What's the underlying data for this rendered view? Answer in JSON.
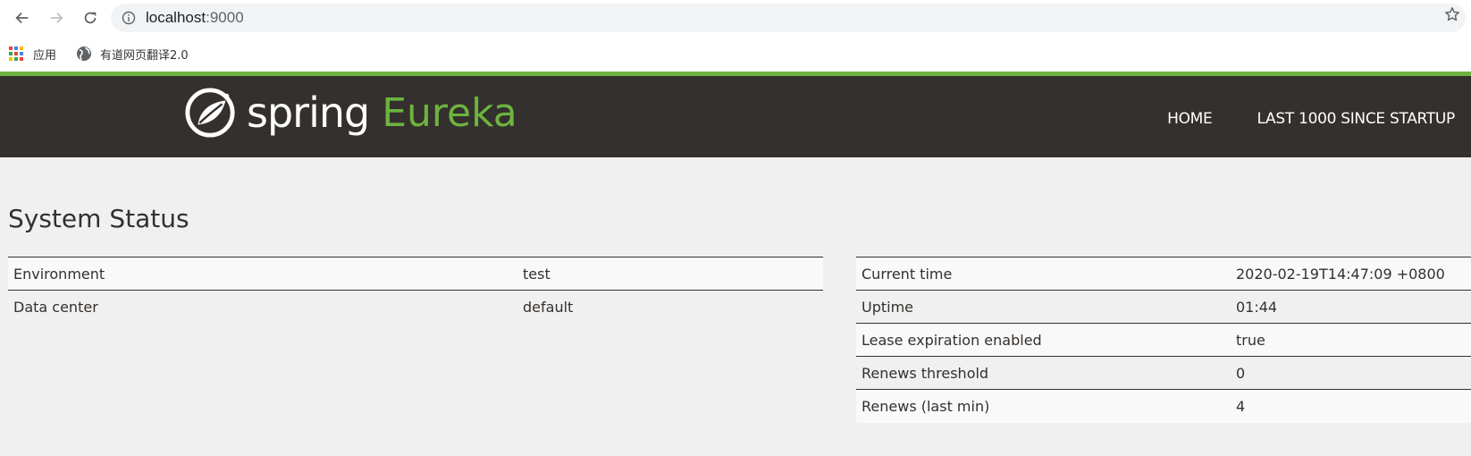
{
  "browser": {
    "url_host": "localhost",
    "url_port": ":9000",
    "bookmarks": [
      {
        "label": "应用",
        "icon": "apps-grid-icon"
      },
      {
        "label": "有道网页翻译2.0",
        "icon": "globe-icon"
      }
    ]
  },
  "header": {
    "logo_spring": "spring",
    "logo_eureka": "Eureka",
    "nav": [
      {
        "label": "HOME"
      },
      {
        "label": "LAST 1000 SINCE STARTUP"
      }
    ],
    "brand_color": "#6db33f",
    "bg_color": "#34302d"
  },
  "system_status": {
    "title": "System Status",
    "left_table": [
      {
        "key": "Environment",
        "value": "test"
      },
      {
        "key": "Data center",
        "value": "default"
      }
    ],
    "right_table": [
      {
        "key": "Current time",
        "value": "2020-02-19T14:47:09 +0800"
      },
      {
        "key": "Uptime",
        "value": "01:44"
      },
      {
        "key": "Lease expiration enabled",
        "value": "true"
      },
      {
        "key": "Renews threshold",
        "value": "0"
      },
      {
        "key": "Renews (last min)",
        "value": "4"
      }
    ]
  }
}
